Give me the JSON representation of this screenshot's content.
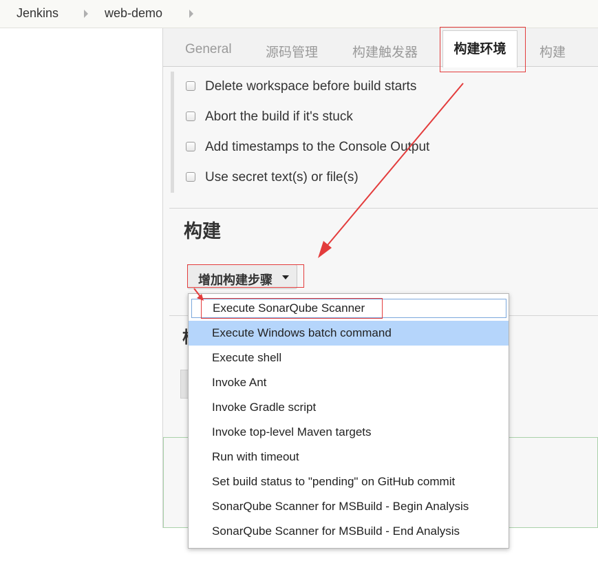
{
  "breadcrumb": {
    "items": [
      "Jenkins",
      "web-demo"
    ]
  },
  "tabs": {
    "items": [
      "General",
      "源码管理",
      "构建触发器",
      "构建环境",
      "构建"
    ],
    "active": "构建环境"
  },
  "build_environment": {
    "options": [
      "Delete workspace before build starts",
      "Abort the build if it's stuck",
      "Add timestamps to the Console Output",
      "Use secret text(s) or file(s)"
    ]
  },
  "build_section": {
    "heading": "构建",
    "add_step_label": "增加构建步骤",
    "post_heading_fragment": "构"
  },
  "dropdown": {
    "items": [
      "Execute SonarQube Scanner",
      "Execute Windows batch command",
      "Execute shell",
      "Invoke Ant",
      "Invoke Gradle script",
      "Invoke top-level Maven targets",
      "Run with timeout",
      "Set build status to \"pending\" on GitHub commit",
      "SonarQube Scanner for MSBuild - Begin Analysis",
      "SonarQube Scanner for MSBuild - End Analysis"
    ],
    "focused_index": 0,
    "highlighted_index": 1
  },
  "colors": {
    "annotation": "#e33c3c",
    "highlight": "#b5d5fb",
    "focus_border": "#7aa7dc"
  }
}
